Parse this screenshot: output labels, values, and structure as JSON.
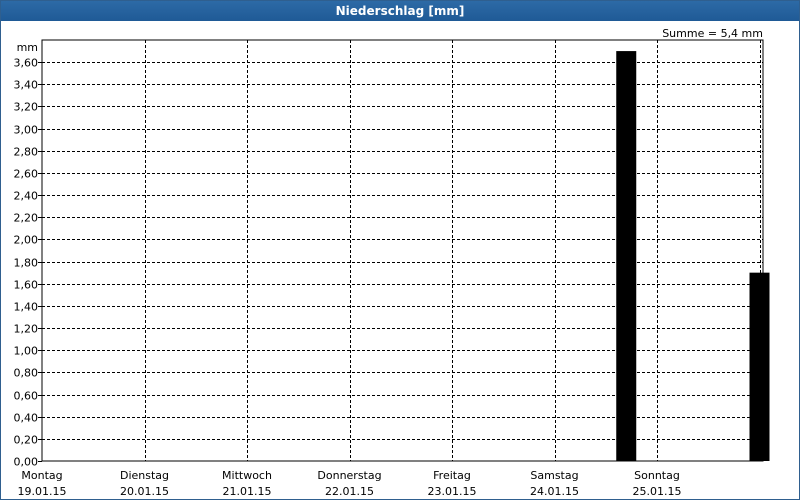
{
  "window": {
    "title": "Niederschlag [mm]"
  },
  "chart_data": {
    "type": "bar",
    "title": "Niederschlag [mm]",
    "ylabel": "mm",
    "summary": "Summe = 5,4 mm",
    "ylim": [
      0,
      3.8
    ],
    "y_step": 0.2,
    "y_tick_labels": [
      "0,00",
      "0,20",
      "0,40",
      "0,60",
      "0,80",
      "1,00",
      "1,20",
      "1,40",
      "1,60",
      "1,80",
      "2,00",
      "2,20",
      "2,40",
      "2,60",
      "2,80",
      "3,00",
      "3,20",
      "3,40",
      "3,60"
    ],
    "categories": [
      {
        "day": "Montag",
        "date": "19.01.15"
      },
      {
        "day": "Dienstag",
        "date": "20.01.15"
      },
      {
        "day": "Mittwoch",
        "date": "21.01.15"
      },
      {
        "day": "Donnerstag",
        "date": "22.01.15"
      },
      {
        "day": "Freitag",
        "date": "23.01.15"
      },
      {
        "day": "Samstag",
        "date": "24.01.15"
      },
      {
        "day": "Sonntag",
        "date": "25.01.15"
      }
    ],
    "bars": [
      {
        "x_days": 5.7,
        "value": 3.7
      },
      {
        "x_days": 7.0,
        "value": 1.7
      }
    ],
    "grid": true,
    "bar_color": "#000000"
  }
}
